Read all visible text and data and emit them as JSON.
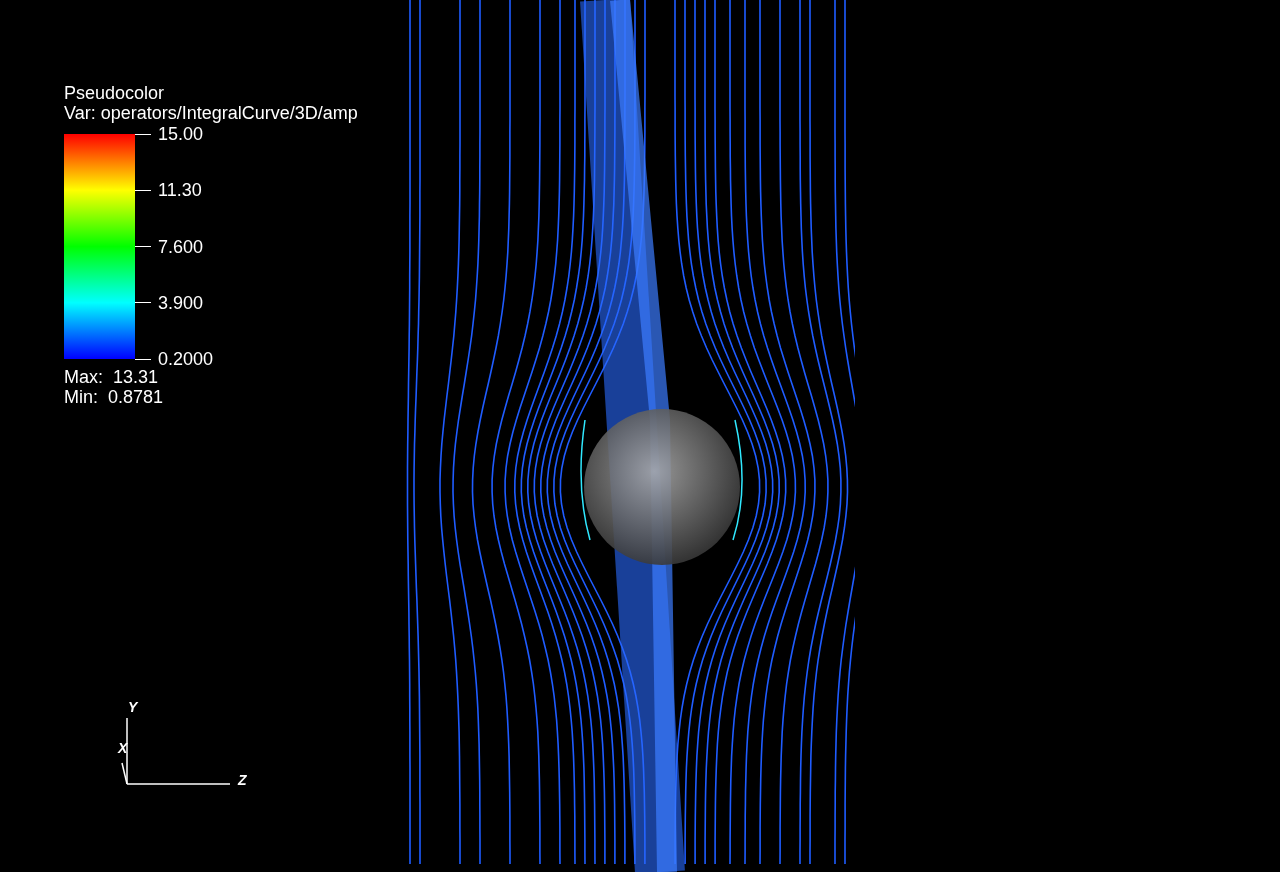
{
  "legend": {
    "title": "Pseudocolor",
    "variable": "Var: operators/IntegralCurve/3D/amp",
    "ticks": [
      "15.00",
      "11.30",
      "7.600",
      "3.900",
      "0.2000"
    ],
    "max": "Max:  13.31",
    "min": "Min:  0.8781"
  },
  "triad": {
    "y": "Y",
    "x": "X",
    "z": "Z"
  }
}
